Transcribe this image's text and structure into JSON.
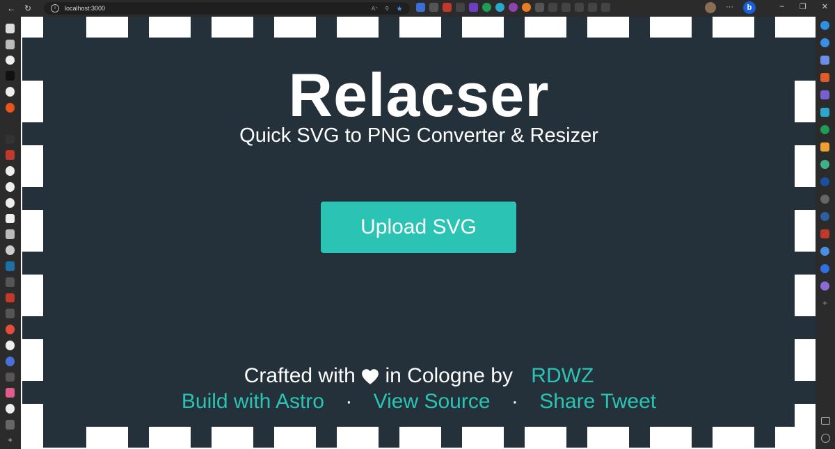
{
  "browser": {
    "url": "localhost:3000"
  },
  "page": {
    "title": "Relacser",
    "subtitle": "Quick SVG to PNG Converter & Resizer",
    "upload_label": "Upload SVG",
    "crafted_prefix": "Crafted with",
    "crafted_suffix": "in Cologne by",
    "author_link": "RDWZ",
    "links": [
      "Build with Astro",
      "View Source",
      "Share Tweet"
    ],
    "separator": "·"
  },
  "colors": {
    "background": "#24313a",
    "accent": "#2bc4b4",
    "frame": "#ffffff"
  }
}
